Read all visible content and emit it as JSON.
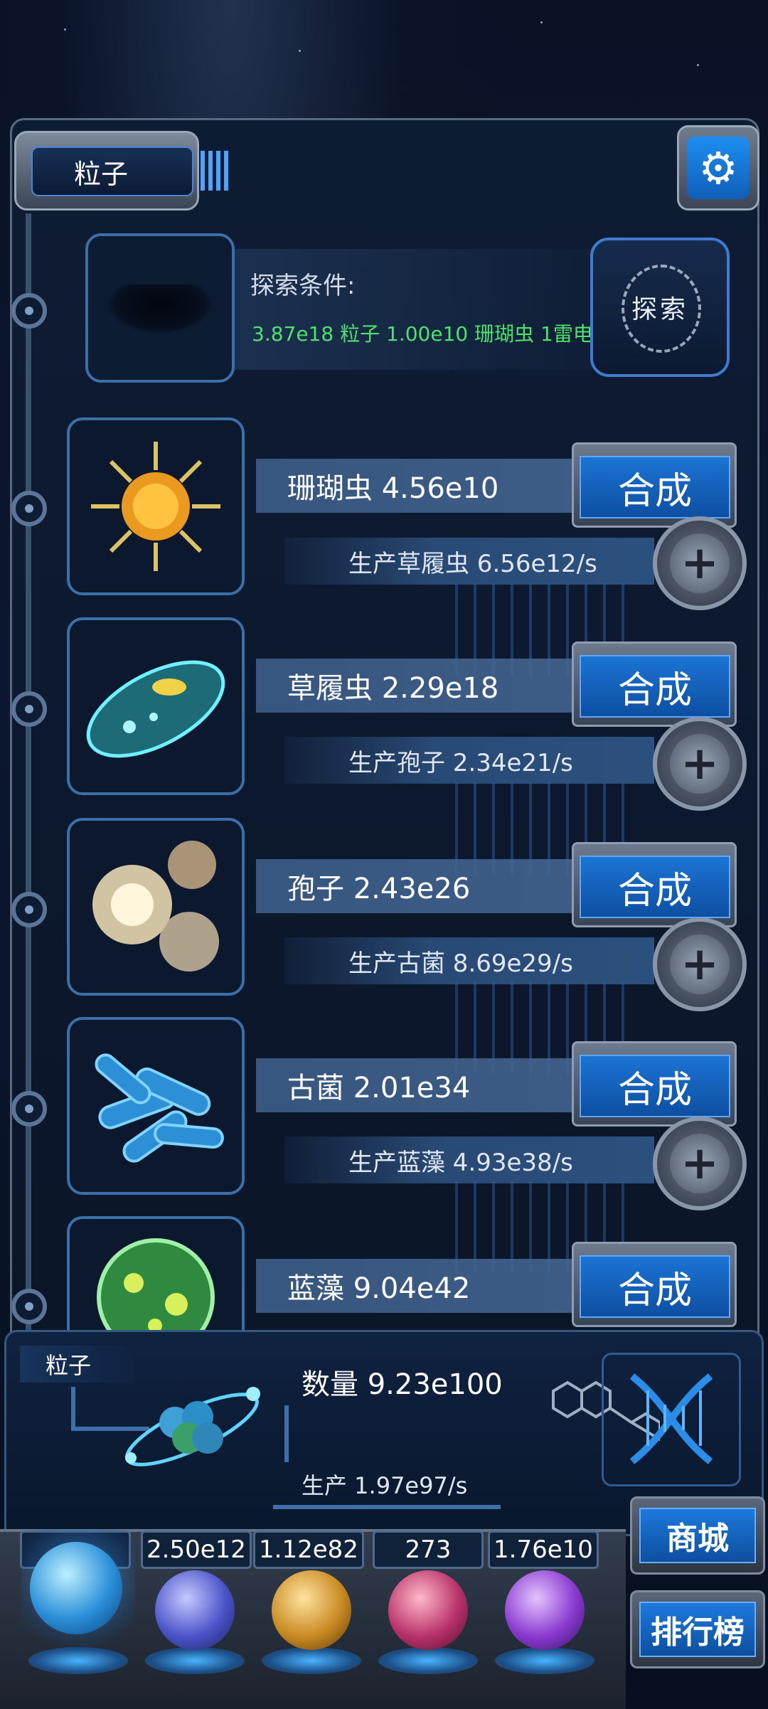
{
  "header": {
    "title": "粒子"
  },
  "explore": {
    "label": "探索条件:",
    "requirement": "3.87e18 粒子 1.00e10 珊瑚虫 1雷电",
    "button": "探索"
  },
  "creatures": [
    {
      "name": "珊瑚虫 4.56e10",
      "production": "生产草履虫 6.56e12/s",
      "synthesize": "合成",
      "icon": "sun-creature-icon"
    },
    {
      "name": "草履虫 2.29e18",
      "production": "生产孢子 2.34e21/s",
      "synthesize": "合成",
      "icon": "paramecium-icon"
    },
    {
      "name": "孢子 2.43e26",
      "production": "生产古菌 8.69e29/s",
      "synthesize": "合成",
      "icon": "spore-icon"
    },
    {
      "name": "古菌 2.01e34",
      "production": "生产蓝藻 4.93e38/s",
      "synthesize": "合成",
      "icon": "archaea-icon"
    },
    {
      "name": "蓝藻 9.04e42",
      "production": "",
      "synthesize": "合成",
      "icon": "cyanobacteria-icon"
    }
  ],
  "summary": {
    "tag": "粒子",
    "count": "数量 9.23e100",
    "rate": "生产 1.97e97/s"
  },
  "resources": [
    {
      "value": "",
      "icon": "particle-orb-icon",
      "color": "#2a8fd8"
    },
    {
      "value": "2.50e12",
      "icon": "lightning-orb-icon",
      "color": "#4a54c8"
    },
    {
      "value": "1.12e82",
      "icon": "fire-orb-icon",
      "color": "#c98a22"
    },
    {
      "value": "273",
      "icon": "brain-orb-icon",
      "color": "#b8326a"
    },
    {
      "value": "1.76e10",
      "icon": "vortex-orb-icon",
      "color": "#8a3ad0"
    }
  ],
  "side_buttons": {
    "shop": "商城",
    "ranking": "排行榜"
  }
}
